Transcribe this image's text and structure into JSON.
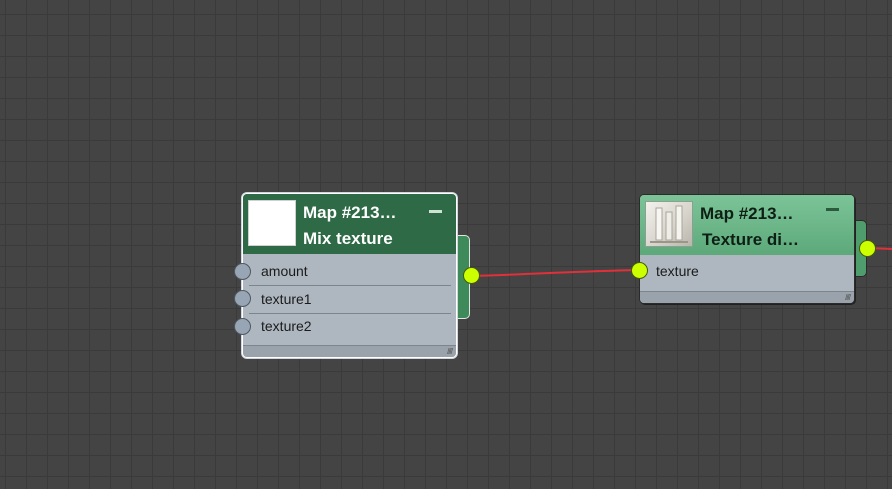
{
  "editor": {
    "name": "Slate Material Editor node view",
    "grid_color": "#3a3a3a",
    "background_color": "#444444",
    "wire_color": "#e0303a"
  },
  "nodes": [
    {
      "title": "Map  #213…",
      "subtitle": "Mix texture",
      "thumbnail": "white-swatch",
      "selected": true,
      "header_color": "#2e6a46",
      "inputs": [
        {
          "label": "amount"
        },
        {
          "label": "texture1"
        },
        {
          "label": "texture2"
        }
      ]
    },
    {
      "title": "Map  #213…",
      "subtitle": "Texture  di…",
      "thumbnail": "texture-preview",
      "selected": false,
      "header_color": "#6db688",
      "inputs": [
        {
          "label": "texture"
        }
      ]
    }
  ],
  "icons": {
    "minimize": "minimize-icon",
    "input_socket": "input-socket-icon",
    "output_socket": "output-socket-icon",
    "resize_grip": "resize-grip-icon"
  },
  "socket_colors": {
    "input": "#97a5b4",
    "output": "#ccff00"
  }
}
